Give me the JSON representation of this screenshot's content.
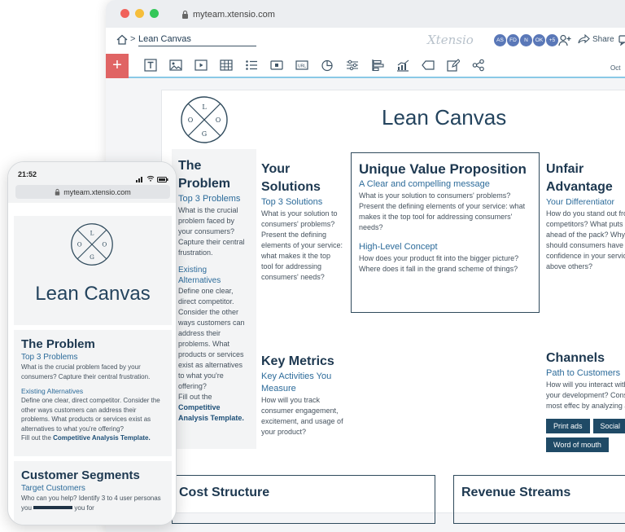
{
  "browser": {
    "url": "myteam.xtensio.com"
  },
  "app": {
    "breadcrumb": "Lean Canvas",
    "brand": "Xtensio",
    "avatars": [
      "AS",
      "FD",
      "N",
      "OK",
      "+5"
    ],
    "share_label": "Share",
    "date_fragment": "Oct"
  },
  "toolbar": {
    "add_label": "+",
    "tools": [
      "text",
      "image",
      "video",
      "table",
      "list",
      "button",
      "url",
      "chart",
      "slider",
      "bar",
      "graph",
      "tag",
      "edit",
      "share-nodes"
    ]
  },
  "logo": {
    "letters": [
      "L",
      "O",
      "G",
      "O"
    ]
  },
  "canvas": {
    "title": "Lean Canvas",
    "problem": {
      "title": "The Problem",
      "subtitle": "Top 3 Problems",
      "text": "What is the crucial problem faced by your consumers? Capture their central frustration.",
      "alt_title": "Existing Alternatives",
      "alt_text": "Define one clear, direct competitor. Consider the other ways customers can address their problems. What products or services exist as alternatives to what you're offering?",
      "fill_prefix": "Fill out the ",
      "fill_link": "Competitive Analysis Template."
    },
    "solutions": {
      "title": "Your Solutions",
      "subtitle": "Top 3 Solutions",
      "text": "What is your solution to consumers' problems? Present the defining elements of your service: what makes it the top tool for addressing consumers' needs?"
    },
    "uvp": {
      "title": "Unique Value Proposition",
      "subtitle": "A Clear and compelling message",
      "text": "What is your solution to consumers' problems? Present the defining elements of your service: what makes it the top tool for addressing consumers' needs?",
      "concept_title": "High-Level Concept",
      "concept_text": "How does your product fit into the bigger picture? Where does it fall in the grand scheme of things?"
    },
    "advantage": {
      "title": "Unfair Advantage",
      "subtitle": "Your Differentiator",
      "text": "How do you stand out from competitors? What puts you ahead of the pack? Why should consumers have confidence in your service above others?"
    },
    "metrics": {
      "title": "Key Metrics",
      "subtitle": "Key Activities You Measure",
      "text": "How will you track consumer engagement, excitement, and usage of your product?"
    },
    "channels": {
      "title": "Channels",
      "subtitle": "Path to Customers",
      "text": "How will you interact with them of your development? Consider the most effec by analyzing a Custome",
      "tags": [
        "Print ads",
        "Social",
        "Word of mouth"
      ]
    },
    "cost": {
      "title": "Cost Structure"
    },
    "revenue": {
      "title": "Revenue Streams"
    }
  },
  "phone": {
    "time": "21:52",
    "url": "myteam.xtensio.com",
    "title": "Lean Canvas",
    "problem_title": "The Problem",
    "problem_subtitle": "Top 3 Problems",
    "problem_text": "What is the crucial problem faced by your consumers? Capture their central frustration.",
    "alt_title": "Existing Alternatives",
    "alt_text": "Define one clear, direct competitor. Consider the other ways customers can address their problems. What products or services exist as alternatives to what you're offering?",
    "fill_prefix": "Fill out the ",
    "fill_link": "Competitive Analysis Template.",
    "segments_title": "Customer Segments",
    "segments_subtitle": "Target Customers",
    "segments_text": "Who can you help? Identify 3 to 4 user personas you",
    "segments_text_end": "you for"
  }
}
